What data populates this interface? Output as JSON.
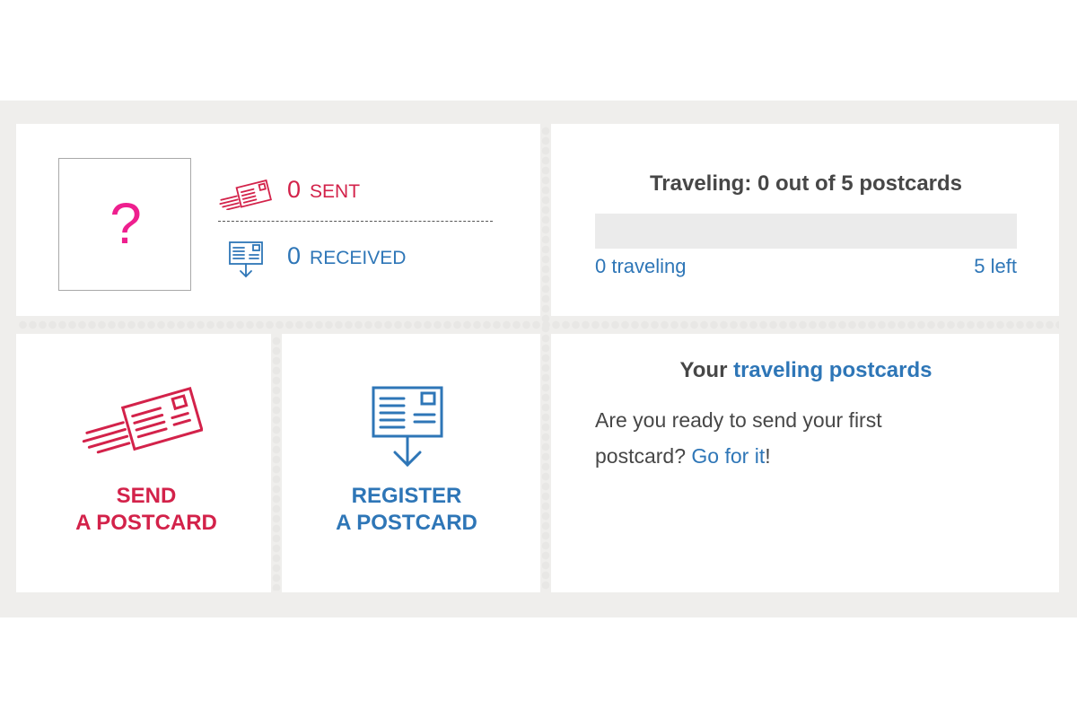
{
  "profile": {
    "avatar_placeholder": "?",
    "avatar_color": "#ee1f8e"
  },
  "stats": {
    "sent": {
      "count": "0",
      "label": "SENT",
      "icon": "send-postcard-icon"
    },
    "received": {
      "count": "0",
      "label": "RECEIVED",
      "icon": "receive-postcard-icon"
    }
  },
  "traveling": {
    "title": "Traveling: 0 out of 5 postcards",
    "progress_fraction": 0,
    "traveling_label": "0 traveling",
    "left_label": "5 left"
  },
  "actions": {
    "send": {
      "line1": "SEND",
      "line2": "A POSTCARD",
      "icon": "send-postcard-icon"
    },
    "register": {
      "line1": "REGISTER",
      "line2": "A POSTCARD",
      "icon": "register-postcard-icon"
    }
  },
  "traveling_postcards": {
    "heading_prefix": "Your ",
    "heading_link": "traveling postcards",
    "message_before": "Are you ready to send your first postcard? ",
    "message_link": "Go for it",
    "message_after": "!"
  },
  "colors": {
    "send_red": "#d3224a",
    "link_blue": "#2e76b7",
    "band_gray": "#efeeec",
    "progress_track": "#ebebeb"
  }
}
